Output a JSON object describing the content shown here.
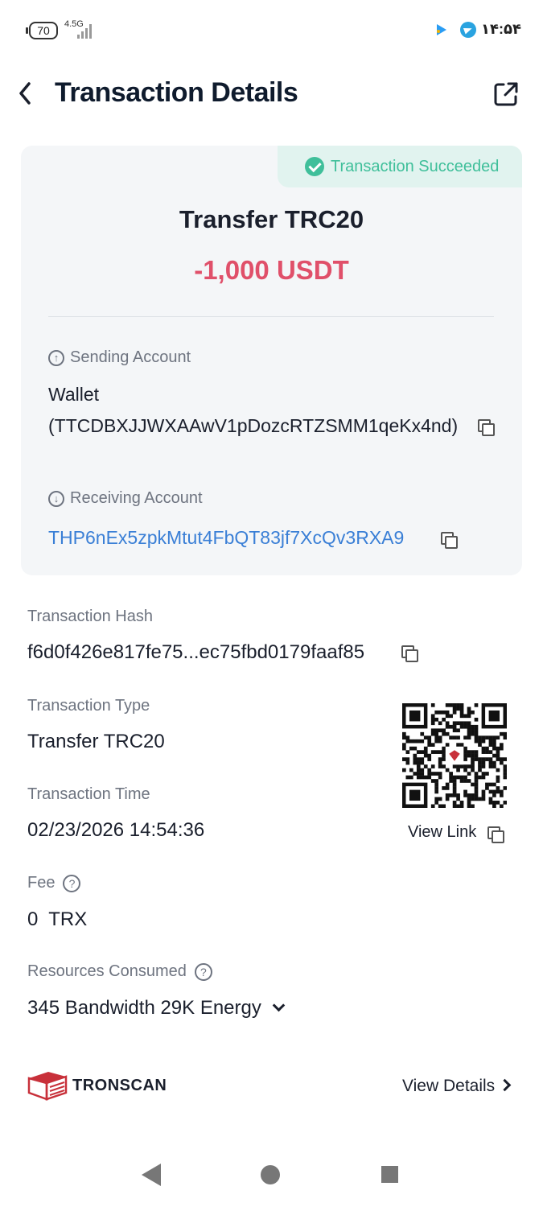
{
  "status_bar": {
    "battery": "70",
    "network": "4.5G",
    "time": "۱۴:۵۴"
  },
  "header": {
    "title": "Transaction Details"
  },
  "summary": {
    "status": "Transaction Succeeded",
    "method": "Transfer TRC20",
    "amount": "-1,000 USDT",
    "status_color": "#3fbf9a",
    "amount_color": "#e0506a"
  },
  "sending": {
    "label": "Sending Account",
    "name": "Wallet",
    "address": "(TTCDBXJJWXAAwV1pDozcRTZSMM1qeKx4nd)"
  },
  "receiving": {
    "label": "Receiving Account",
    "address": "THP6nEx5zpkMtut4FbQT83jf7XcQv3RXA9",
    "link_color": "#3a7fd6"
  },
  "details": {
    "hash_label": "Transaction Hash",
    "hash_value": "f6d0f426e817fe75...ec75fbd0179faaf85",
    "type_label": "Transaction Type",
    "type_value": "Transfer TRC20",
    "time_label": "Transaction Time",
    "time_value": "02/23/2026 14:54:36",
    "fee_label": "Fee",
    "fee_value": "0  TRX",
    "resources_label": "Resources Consumed",
    "resources_value": "345 Bandwidth 29K Energy"
  },
  "qr": {
    "view_link": "View Link"
  },
  "footer": {
    "brand": "TRONSCAN",
    "view_details": "View Details",
    "brand_color": "#c8303a"
  }
}
